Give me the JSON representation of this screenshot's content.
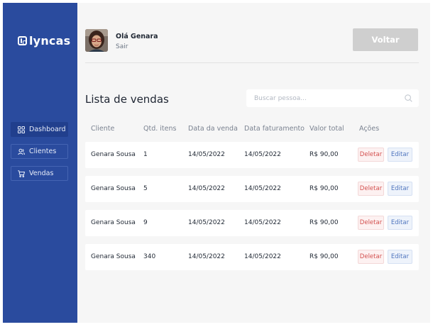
{
  "brand": {
    "name": "lyncas"
  },
  "sidebar": {
    "items": [
      {
        "label": "Dashboard",
        "icon": "grid-icon",
        "active": true
      },
      {
        "label": "Clientes",
        "icon": "users-icon",
        "active": false
      },
      {
        "label": "Vendas",
        "icon": "cart-icon",
        "active": false
      }
    ]
  },
  "header": {
    "greeting": "Olá Genara",
    "logout_label": "Sair",
    "back_label": "Voltar"
  },
  "main": {
    "title": "Lista de vendas",
    "search": {
      "placeholder": "Buscar pessoa..."
    },
    "columns": [
      "Cliente",
      "Qtd. itens",
      "Data da venda",
      "Data faturamento",
      "Valor total",
      "Ações"
    ],
    "rows": [
      {
        "cliente": "Genara Sousa",
        "qtd": "1",
        "data_venda": "14/05/2022",
        "data_faturamento": "14/05/2022",
        "valor": "R$ 90,00",
        "delete_label": "Deletar",
        "edit_label": "Editar"
      },
      {
        "cliente": "Genara Sousa",
        "qtd": "5",
        "data_venda": "14/05/2022",
        "data_faturamento": "14/05/2022",
        "valor": "R$ 90,00",
        "delete_label": "Deletar",
        "edit_label": "Editar"
      },
      {
        "cliente": "Genara Sousa",
        "qtd": "9",
        "data_venda": "14/05/2022",
        "data_faturamento": "14/05/2022",
        "valor": "R$ 90,00",
        "delete_label": "Deletar",
        "edit_label": "Editar"
      },
      {
        "cliente": "Genara Sousa",
        "qtd": "340",
        "data_venda": "14/05/2022",
        "data_faturamento": "14/05/2022",
        "valor": "R$ 90,00",
        "delete_label": "Deletar",
        "edit_label": "Editar"
      }
    ]
  },
  "colors": {
    "sidebar": "#2a4b9e",
    "sidebar_active": "#213f8d",
    "background": "#f6f6f6",
    "back_button": "#cfcfcf",
    "delete": "#d3504f",
    "edit": "#4f75be"
  }
}
